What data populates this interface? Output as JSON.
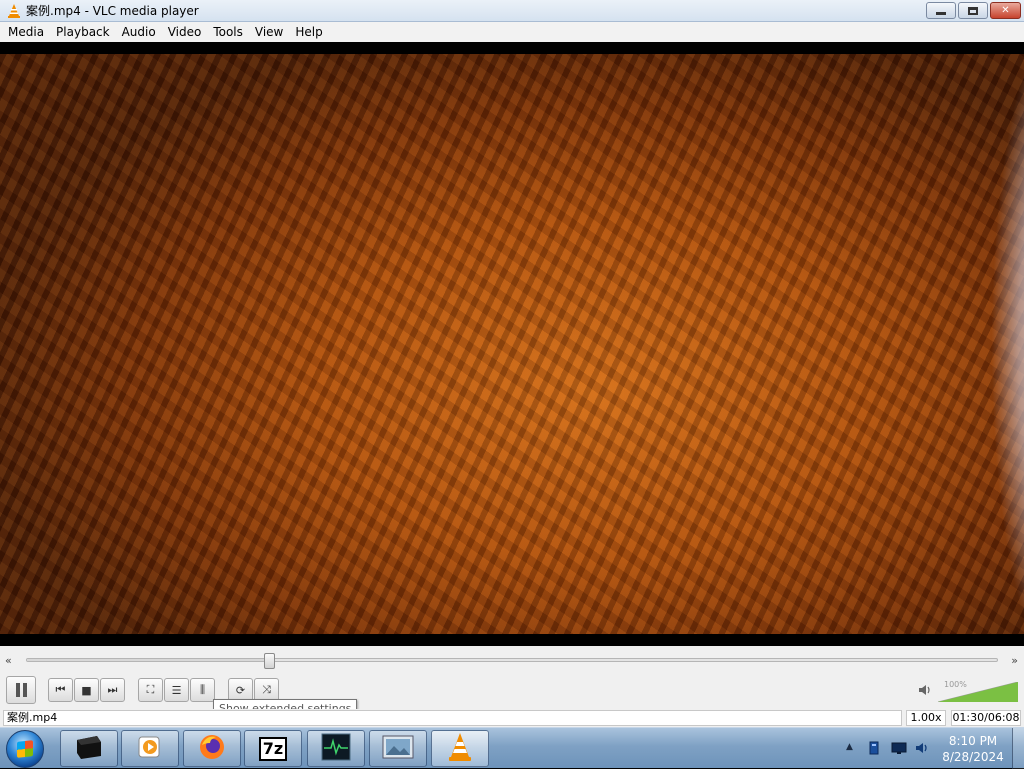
{
  "window": {
    "title": "案例.mp4 - VLC media player",
    "app_icon": "vlc-cone-icon",
    "buttons": {
      "minimize": "▭",
      "maximize": "❐",
      "close": "✕"
    }
  },
  "menu": [
    {
      "label": "Media"
    },
    {
      "label": "Playback"
    },
    {
      "label": "Audio"
    },
    {
      "label": "Video"
    },
    {
      "label": "Tools"
    },
    {
      "label": "View"
    },
    {
      "label": "Help"
    }
  ],
  "player": {
    "seek_position": 0.2494,
    "seek_back_icon": "«",
    "seek_forward_icon": "»",
    "tooltip": "Show extended settings",
    "volume_label": "100%",
    "volume_level": 1.0,
    "controls": {
      "pause": "pause-icon",
      "previous": "⏮",
      "stop": "■",
      "next": "⏭",
      "fullscreen": "⛶",
      "playlist": "☰",
      "extended": "⫼",
      "loop": "⟳",
      "shuffle": "⤨",
      "volume_icon": "🔈"
    }
  },
  "status": {
    "filename": "案例.mp4",
    "speed": "1.00x",
    "time": "01:30/06:08"
  },
  "taskbar": {
    "apps": [
      {
        "name": "terminal"
      },
      {
        "name": "media-player"
      },
      {
        "name": "firefox"
      },
      {
        "name": "7zip",
        "label": "7z"
      },
      {
        "name": "monitor"
      },
      {
        "name": "image-viewer"
      },
      {
        "name": "vlc",
        "active": true
      }
    ],
    "clock_time": "8:10 PM",
    "clock_date": "8/28/2024"
  },
  "colors": {
    "accent": "#2f86d6",
    "vlc_orange": "#f08c00",
    "close_red": "#c7432d"
  }
}
